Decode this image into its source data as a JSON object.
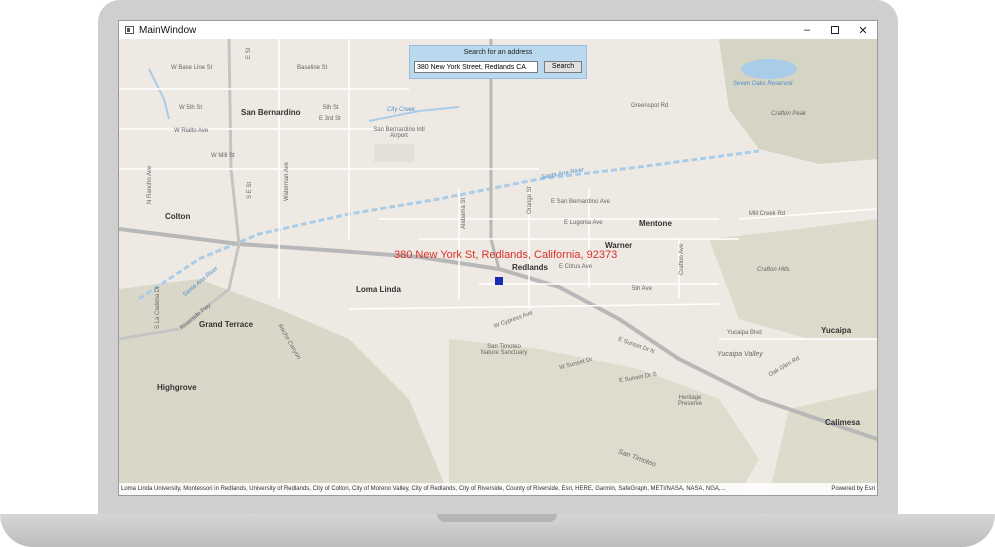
{
  "window": {
    "title": "MainWindow",
    "minimize_glyph": "–",
    "close_glyph": "✕"
  },
  "search": {
    "title": "Search for an address",
    "input_value": "380 New York Street, Redlands CA",
    "button_label": "Search"
  },
  "result": {
    "label": "380 New York St, Redlands, California, 92373",
    "marker_color": "#1c2bb5",
    "label_color": "#d9302c"
  },
  "map": {
    "cities": [
      "San Bernardino",
      "Colton",
      "Loma Linda",
      "Redlands",
      "Grand Terrace",
      "Highgrove",
      "Mentone",
      "Warner",
      "Yucaipa",
      "Calimesa",
      "Crafton Hills",
      "Yucaipa Valley"
    ],
    "roads": [
      "W Base Line St",
      "Baseline St",
      "W 5th St",
      "5th St",
      "E 3rd St",
      "W Rialto Ave",
      "W Mill St",
      "Greenspot Rd",
      "E San Bernardino Ave",
      "E Lugonia Ave",
      "E Citrus Ave",
      "5th Ave",
      "W Cypress Ave",
      "Mill Creek Rd",
      "Yucaipa Blvd",
      "Oak Glen Rd",
      "E Sunset Dr N",
      "W Sunset Dr",
      "E Sunset Dr S",
      "Alabama St",
      "Orange St",
      "Crafton Ave",
      "Waterman Ave",
      "S E St",
      "E St",
      "N Rancho Ave",
      "S La Cadena Dr",
      "Riverside Fwy",
      "Reche Canyon"
    ],
    "water": [
      "City Creek",
      "Santa Ana River",
      "Seven Oaks Reservoir"
    ],
    "places": [
      "San Bernardino Intl Airport",
      "San Timoteo Nature Sanctuary",
      "Heritage Preserve",
      "Crafton Peak",
      "San Timoteo"
    ]
  },
  "attribution": {
    "text": "Loma Linda University, Montessori in Redlands, University of Redlands, City of Colton, City of Moreno Valley, City of Redlands, City of Riverside, County of Riverside, Esri, HERE, Garmin, SafeGraph, METI/NASA, NASA, NGA,...",
    "powered_by": "Powered by Esri"
  }
}
